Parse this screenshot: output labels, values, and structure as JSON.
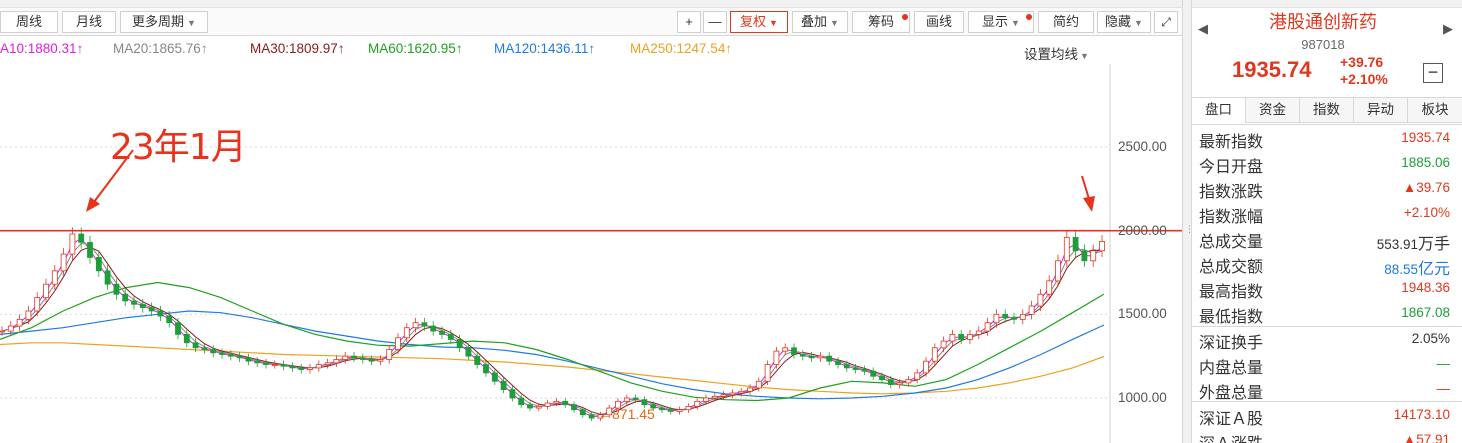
{
  "toolbar": {
    "period_buttons": [
      {
        "label": "周线"
      },
      {
        "label": "月线"
      },
      {
        "label": "更多周期"
      }
    ],
    "right_buttons": [
      {
        "label": "+"
      },
      {
        "label": "—"
      },
      {
        "label": "复权"
      },
      {
        "label": "叠加"
      },
      {
        "label": "筹码"
      },
      {
        "label": "画线"
      },
      {
        "label": "显示"
      },
      {
        "label": "简约"
      },
      {
        "label": "隐藏"
      }
    ]
  },
  "ma_legend": [
    {
      "text": "A10:1880.31",
      "arrow": "↑",
      "color": "#e020e0"
    },
    {
      "text": "MA20:1865.76",
      "arrow": "↑",
      "color": "#888888"
    },
    {
      "text": "MA30:1809.97",
      "arrow": "↑",
      "color": "#8a1a1a"
    },
    {
      "text": "MA60:1620.95",
      "arrow": "↑",
      "color": "#20a020"
    },
    {
      "text": "MA120:1436.11",
      "arrow": "↑",
      "color": "#1f7be0"
    },
    {
      "text": "MA250:1247.54",
      "arrow": "↑",
      "color": "#f0a020"
    }
  ],
  "ma_settings_label": "设置均线",
  "annotation": {
    "text": "23年1月"
  },
  "low_label": "←871.45",
  "y_ticks": [
    "2500.00",
    "2000.00",
    "1500.00",
    "1000.00"
  ],
  "quote": {
    "name": "港股通创新药",
    "code": "987018",
    "price": "1935.74",
    "change": "+39.76",
    "change_pct": "+2.10%"
  },
  "tabs": [
    "盘口",
    "资金",
    "指数",
    "异动",
    "板块"
  ],
  "rows": [
    {
      "label": "最新指数",
      "value": "1935.74",
      "color": "red"
    },
    {
      "label": "今日开盘",
      "value": "1885.06",
      "color": "green"
    },
    {
      "label": "指数涨跌",
      "value": "▲39.76",
      "color": "red"
    },
    {
      "label": "指数涨幅",
      "value": "+2.10%",
      "color": "red"
    },
    {
      "label": "总成交量",
      "value": "553.91",
      "unit": "万手",
      "color": "dark"
    },
    {
      "label": "总成交额",
      "value": "88.55",
      "unit": "亿元",
      "color": "blue"
    },
    {
      "label": "最高指数",
      "value": "1948.36",
      "color": "red"
    },
    {
      "label": "最低指数",
      "value": "1867.08",
      "color": "green"
    },
    {
      "label": "深证换手",
      "value": "2.05%",
      "color": "dark"
    },
    {
      "label": "内盘总量",
      "value": "—",
      "color": "green"
    },
    {
      "label": "外盘总量",
      "value": "—",
      "color": "red"
    },
    {
      "label": "深证Ａ股",
      "value": "14173.10",
      "color": "red"
    },
    {
      "label": "深Ａ涨跌",
      "value": "▲57.91",
      "color": "red"
    }
  ],
  "colors": {
    "up": "#e0371f",
    "down": "#1d9e3a",
    "accent": "#e0371f",
    "resistance_line": "#e8331c"
  },
  "chart_data": {
    "type": "line",
    "title": "",
    "xlabel": "",
    "ylabel": "",
    "ylim": [
      850,
      2650
    ],
    "horizontal_line": 2000,
    "low_marker": 871.45,
    "series": [
      {
        "name": "MA250",
        "values": [
          1320,
          1330,
          1330,
          1320,
          1310,
          1300,
          1290,
          1280,
          1270,
          1260,
          1255,
          1250,
          1245,
          1240,
          1235,
          1225,
          1215,
          1200,
          1185,
          1165,
          1145,
          1125,
          1105,
          1085,
          1065,
          1050,
          1040,
          1030,
          1025,
          1030,
          1040,
          1060,
          1090,
          1130,
          1180,
          1248
        ]
      },
      {
        "name": "MA120",
        "values": [
          1380,
          1400,
          1420,
          1450,
          1480,
          1500,
          1520,
          1510,
          1480,
          1440,
          1400,
          1370,
          1340,
          1320,
          1305,
          1300,
          1285,
          1260,
          1220,
          1175,
          1130,
          1085,
          1050,
          1025,
          1010,
          1000,
          995,
          1000,
          1010,
          1030,
          1060,
          1110,
          1180,
          1260,
          1350,
          1436
        ]
      },
      {
        "name": "MA60",
        "values": [
          1350,
          1420,
          1520,
          1600,
          1660,
          1690,
          1660,
          1600,
          1520,
          1440,
          1380,
          1340,
          1315,
          1310,
          1325,
          1340,
          1330,
          1290,
          1230,
          1160,
          1090,
          1040,
          1005,
          990,
          985,
          1000,
          1060,
          1100,
          1090,
          1070,
          1110,
          1200,
          1300,
          1400,
          1510,
          1621
        ]
      }
    ],
    "candles_close": [
      1400,
      1430,
      1470,
      1520,
      1600,
      1680,
      1760,
      1860,
      1980,
      1930,
      1840,
      1760,
      1680,
      1620,
      1580,
      1560,
      1540,
      1520,
      1490,
      1450,
      1380,
      1330,
      1300,
      1290,
      1270,
      1260,
      1250,
      1240,
      1220,
      1210,
      1200,
      1200,
      1190,
      1180,
      1170,
      1180,
      1200,
      1210,
      1230,
      1250,
      1240,
      1230,
      1220,
      1230,
      1290,
      1360,
      1420,
      1450,
      1430,
      1400,
      1380,
      1350,
      1300,
      1250,
      1200,
      1150,
      1100,
      1050,
      1000,
      960,
      940,
      950,
      970,
      980,
      960,
      930,
      900,
      880,
      900,
      940,
      980,
      1000,
      990,
      960,
      940,
      930,
      920,
      930,
      950,
      980,
      1000,
      1010,
      1020,
      1030,
      1040,
      1060,
      1100,
      1200,
      1280,
      1300,
      1260,
      1250,
      1240,
      1250,
      1220,
      1200,
      1180,
      1170,
      1160,
      1130,
      1110,
      1080,
      1090,
      1110,
      1150,
      1220,
      1300,
      1340,
      1380,
      1350,
      1380,
      1400,
      1450,
      1500,
      1480,
      1470,
      1500,
      1550,
      1620,
      1700,
      1820,
      1960,
      1880,
      1820,
      1880,
      1935.74
    ]
  }
}
